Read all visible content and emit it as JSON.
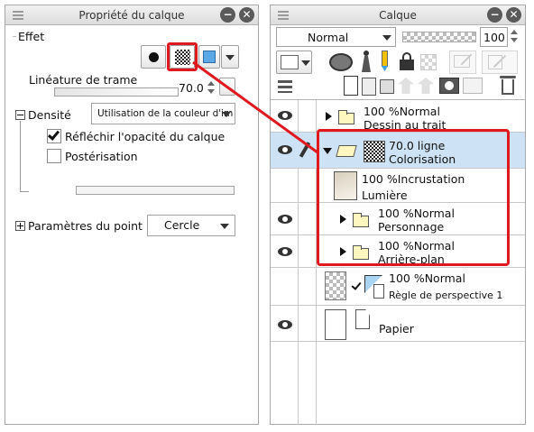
{
  "left_panel": {
    "title": "Propriété du calque",
    "effect_label": "Effet",
    "screen_freq_label": "Linéature de trame",
    "screen_freq_value": "70.0",
    "density_label": "Densité",
    "density_value": "Utilisation de la couleur d'im",
    "reflect_opacity_label": "Réfléchir l'opacité du calque",
    "reflect_opacity_checked": true,
    "posterize_label": "Postérisation",
    "posterize_checked": false,
    "dot_params_label": "Paramètres du point",
    "dot_shape_value": "Cercle"
  },
  "right_panel": {
    "title": "Calque",
    "blend_mode": "Normal",
    "opacity_value": "100",
    "layers": [
      {
        "top": "100 %Normal",
        "bottom": "Dessin au trait",
        "type": "folder",
        "expanded": false
      },
      {
        "top": "70.0 ligne",
        "bottom": "Colorisation",
        "type": "folder",
        "expanded": true,
        "selected": true
      },
      {
        "top": "100 %Incrustation",
        "bottom": "Lumière",
        "type": "layer"
      },
      {
        "top": "100 %Normal",
        "bottom": "Personnage",
        "type": "folder",
        "expanded": false
      },
      {
        "top": "100 %Normal",
        "bottom": "Arrière-plan",
        "type": "folder",
        "expanded": false
      },
      {
        "top": "100 %Normal",
        "bottom": "Règle de perspective 1",
        "type": "ruler"
      },
      {
        "top": "",
        "bottom": "Papier",
        "type": "paper"
      }
    ]
  },
  "colors": {
    "highlight_red": "#e0191f",
    "selected_row": "#cde3f5",
    "accent_blue": "#5aa8e6"
  }
}
